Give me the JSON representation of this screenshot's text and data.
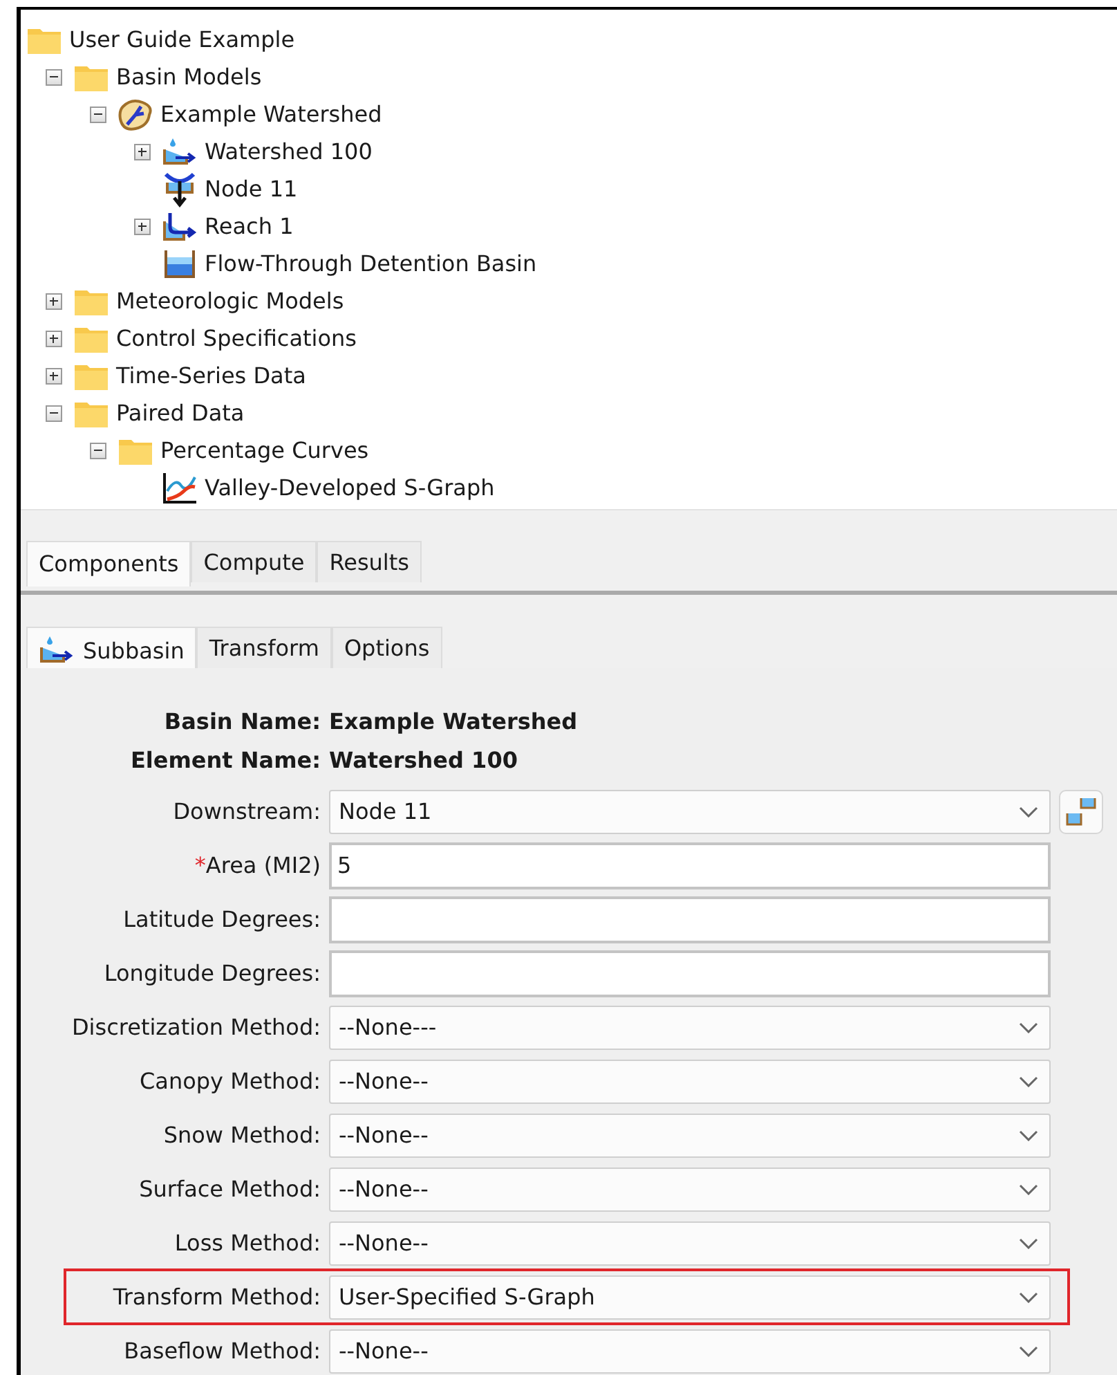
{
  "tree": [
    {
      "label": "User Guide Example",
      "kind": "folder",
      "children": [
        {
          "label": "Basin Models",
          "kind": "folder",
          "expanded": true,
          "children": [
            {
              "label": "Example Watershed",
              "kind": "basin",
              "expanded": true,
              "children": [
                {
                  "label": "Watershed 100",
                  "kind": "subbasin",
                  "expanded": false
                },
                {
                  "label": "Node 11",
                  "kind": "junction"
                },
                {
                  "label": "Reach 1",
                  "kind": "reach",
                  "expanded": false
                },
                {
                  "label": "Flow-Through Detention Basin",
                  "kind": "reservoir"
                }
              ]
            }
          ]
        },
        {
          "label": "Meteorologic Models",
          "kind": "folder",
          "expanded": false
        },
        {
          "label": "Control Specifications",
          "kind": "folder",
          "expanded": false
        },
        {
          "label": "Time-Series Data",
          "kind": "folder",
          "expanded": false
        },
        {
          "label": "Paired Data",
          "kind": "folder",
          "expanded": true,
          "children": [
            {
              "label": "Percentage Curves",
              "kind": "folder",
              "expanded": true,
              "children": [
                {
                  "label": "Valley-Developed S-Graph",
                  "kind": "paired-data"
                }
              ]
            }
          ]
        }
      ]
    }
  ],
  "explorer_tabs": [
    {
      "label": "Components",
      "selected": true
    },
    {
      "label": "Compute",
      "selected": false
    },
    {
      "label": "Results",
      "selected": false
    }
  ],
  "editor_tabs": [
    {
      "label": "Subbasin",
      "selected": true,
      "kind": "subbasin"
    },
    {
      "label": "Transform",
      "selected": false
    },
    {
      "label": "Options",
      "selected": false
    }
  ],
  "info": [
    {
      "label": "Basin Name:",
      "value": "Example Watershed"
    },
    {
      "label": "Element Name:",
      "value": "Watershed 100"
    }
  ],
  "fields": [
    {
      "label": "Downstream:",
      "kind": "select",
      "value": "Node 11",
      "required": false,
      "highlighted": false,
      "has_button": true
    },
    {
      "label": "Area (MI2)",
      "kind": "text",
      "value": "5",
      "required": true,
      "highlighted": false
    },
    {
      "label": "Latitude Degrees:",
      "kind": "text",
      "required": false,
      "highlighted": false
    },
    {
      "label": "Longitude Degrees:",
      "kind": "text",
      "required": false,
      "highlighted": false
    },
    {
      "label": "Discretization Method:",
      "kind": "select",
      "value": "--None---",
      "required": false,
      "highlighted": false
    },
    {
      "label": "Canopy Method:",
      "kind": "select",
      "value": "--None--",
      "required": false,
      "highlighted": false
    },
    {
      "label": "Snow Method:",
      "kind": "select",
      "value": "--None--",
      "required": false,
      "highlighted": false
    },
    {
      "label": "Surface Method:",
      "kind": "select",
      "value": "--None--",
      "required": false,
      "highlighted": false
    },
    {
      "label": "Loss Method:",
      "kind": "select",
      "value": "--None--",
      "required": false,
      "highlighted": false
    },
    {
      "label": "Transform Method:",
      "kind": "select",
      "value": "User-Specified S-Graph",
      "required": false,
      "highlighted": true
    },
    {
      "label": "Baseflow Method:",
      "kind": "select",
      "value": "--None--",
      "required": false,
      "highlighted": false
    }
  ],
  "required_mark": "*"
}
